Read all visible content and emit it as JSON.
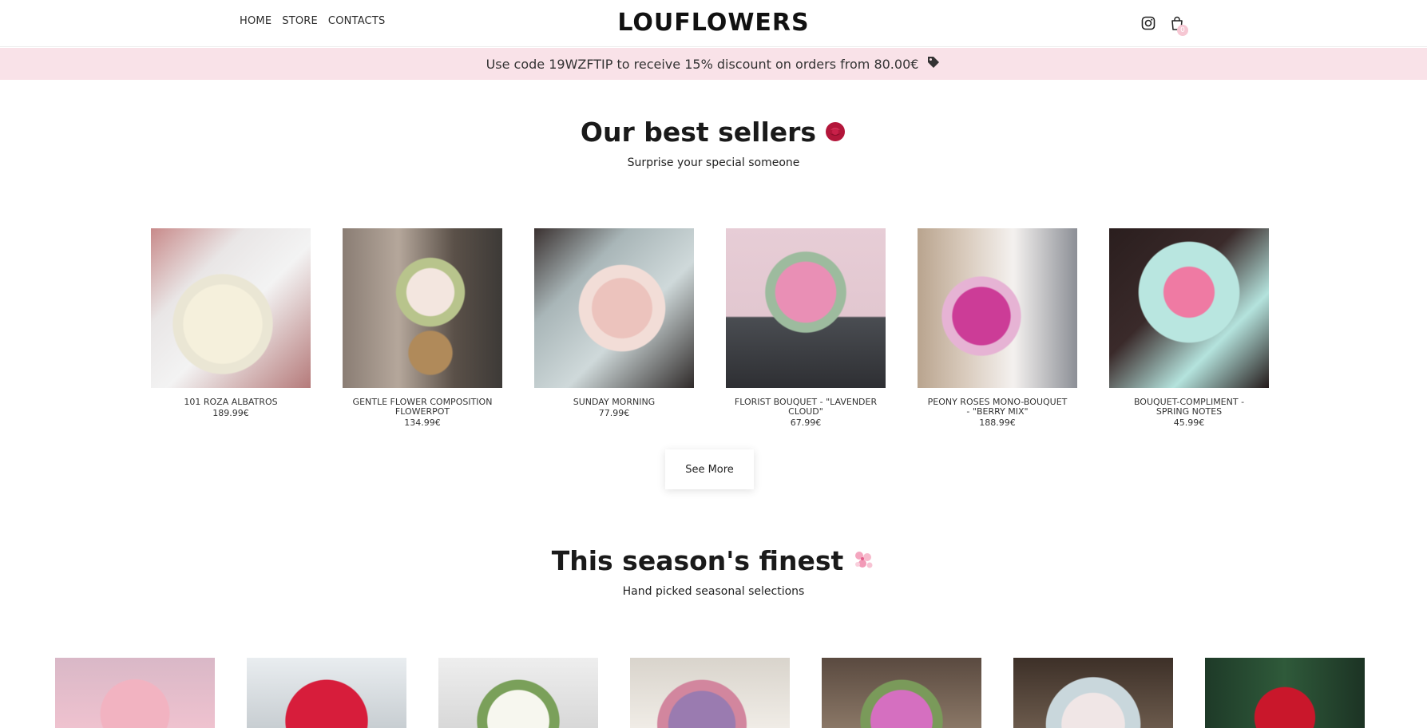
{
  "nav": {
    "items": [
      "HOME",
      "STORE",
      "CONTACTS"
    ]
  },
  "logo": {
    "text": "LOUFLOWERS"
  },
  "header_icons": {
    "instagram": "instagram-icon",
    "cart": "shopping-bag-icon",
    "cart_count": "0"
  },
  "promo": {
    "text": "Use code 19WZFTIP to receive 15% discount on orders from 80.00€",
    "icon": "tag-icon"
  },
  "best_sellers": {
    "title": "Our best sellers",
    "subtitle": "Surprise your special someone",
    "products": [
      {
        "name": "101 ROZA ALBATROS",
        "price": "189.99€"
      },
      {
        "name": "GENTLE FLOWER COMPOSITION FLOWERPOT",
        "price": "134.99€"
      },
      {
        "name": "SUNDAY MORNING",
        "price": "77.99€"
      },
      {
        "name": "FLORIST BOUQUET - \"LAVENDER CLOUD\"",
        "price": "67.99€"
      },
      {
        "name": "PEONY ROSES MONO-BOUQUET - \"BERRY MIX\"",
        "price": "188.99€"
      },
      {
        "name": "BOUQUET-COMPLIMENT - SPRING NOTES",
        "price": "45.99€"
      }
    ],
    "see_more": "See More"
  },
  "season": {
    "title": "This season's finest",
    "subtitle": "Hand picked seasonal selections"
  },
  "colors": {
    "promo_bg": "#f9e2e8",
    "rose": "#b3163a",
    "blossom": "#f4a6bf"
  }
}
